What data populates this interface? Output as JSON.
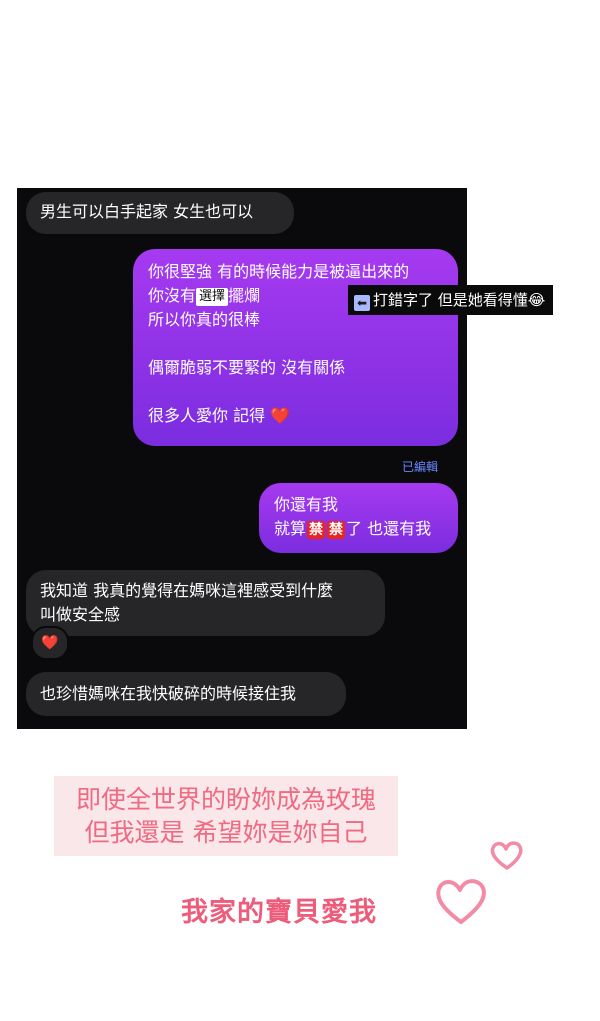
{
  "chat": {
    "messages": [
      {
        "side": "incoming",
        "text": "男生可以白手起家 女生也可以"
      },
      {
        "side": "outgoing",
        "lines": [
          "你很堅強 有的時候能力是被逼出來的",
          {
            "before": "你沒有",
            "boxed": "選擇",
            "after": "擺爛"
          },
          "所以你真的很棒",
          "",
          "偶爾脆弱不要緊的 沒有關係",
          "",
          {
            "text": "很多人愛你 記得",
            "emoji": "❤️"
          }
        ]
      },
      {
        "side": "outgoing",
        "lines": [
          "你還有我",
          {
            "before": "就算",
            "stamp1": "禁",
            "stamp2": "禁",
            "after": "了 也還有我"
          }
        ]
      },
      {
        "side": "incoming",
        "lines": [
          "我知道 我真的覺得在媽咪這裡感受到什麼",
          "叫做安全感"
        ],
        "reaction": "❤️"
      },
      {
        "side": "incoming",
        "text": "也珍惜媽咪在我快破碎的時候接住我"
      }
    ],
    "edited_label": "已編輯"
  },
  "annotation": {
    "icon": "back-arrow-icon",
    "text": "打錯字了 但是她看得懂",
    "emoji": "😂"
  },
  "caption": {
    "line1": "即使全世界的盼妳成為玫瑰",
    "line2": "但我還是 希望妳是妳自己"
  },
  "title": "我家的寶貝愛我",
  "colors": {
    "outgoing_bubble": "#9035e8",
    "incoming_bubble": "#262629",
    "caption_bg": "#f9e7e9",
    "pink_text": "#ee5c7b"
  }
}
